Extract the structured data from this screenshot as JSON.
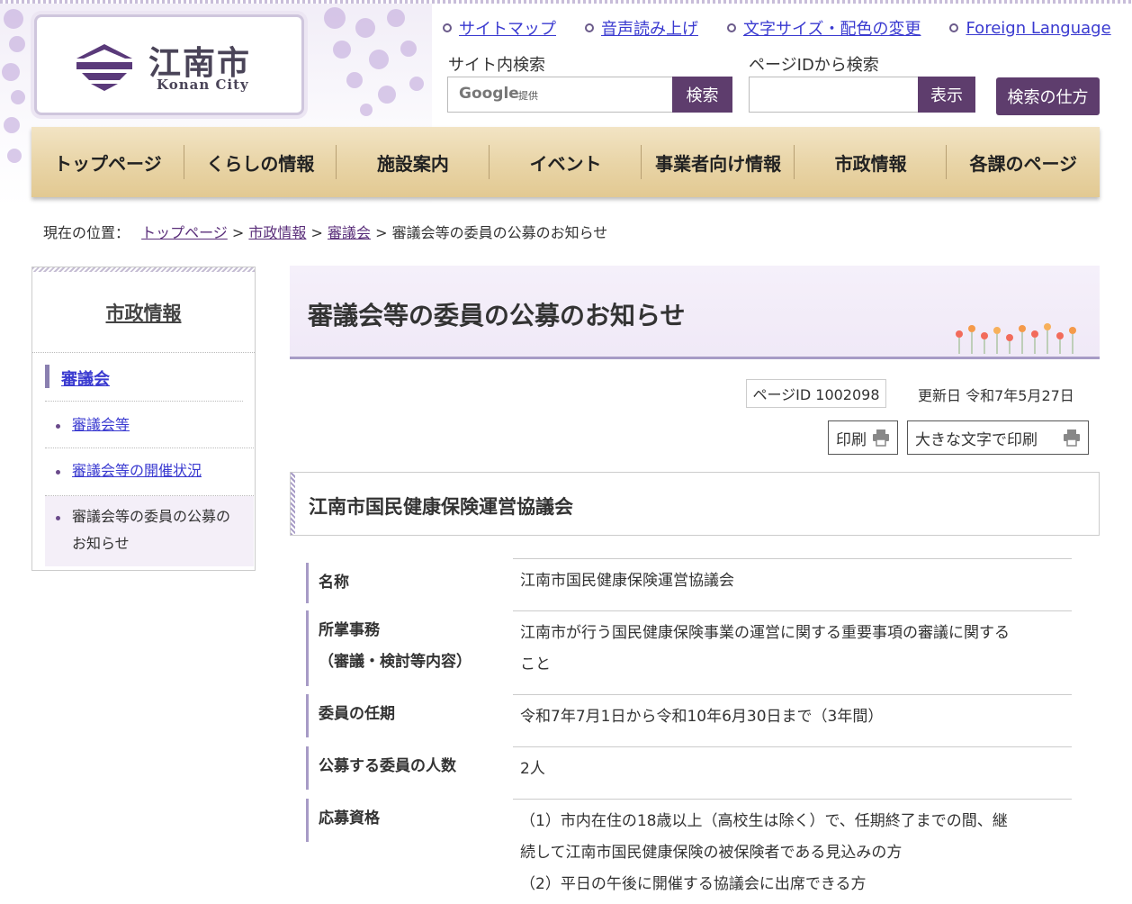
{
  "header": {
    "logo_text": "江南市",
    "logo_sub": "Konan City",
    "links": [
      "サイトマップ",
      "音声読み上げ",
      "文字サイズ・配色の変更",
      "Foreign Language"
    ],
    "site_search_label": "サイト内検索",
    "google_label": "Google",
    "google_provided": "提供",
    "search_button": "検索",
    "pageid_search_label": "ページIDから検索",
    "show_button": "表示",
    "howto_button": "検索の仕方",
    "accent_color": "#5e3d6d"
  },
  "nav": [
    "トップページ",
    "くらしの情報",
    "施設案内",
    "イベント",
    "事業者向け情報",
    "市政情報",
    "各課のページ"
  ],
  "breadcrumb": {
    "prefix": "現在の位置：",
    "items": [
      "トップページ",
      "市政情報",
      "審議会"
    ],
    "sep": ">",
    "current": "審議会等の委員の公募のお知らせ"
  },
  "sidebar": {
    "title": "市政情報",
    "current_section": "審議会",
    "items": [
      "審議会等",
      "審議会等の開催状況"
    ],
    "active_item_line1": "審議会等の委員の公募の",
    "active_item_line2": "お知らせ"
  },
  "page": {
    "title": "審議会等の委員の公募のお知らせ",
    "page_id": "ページID 1002098",
    "updated": "更新日 令和7年5月27日",
    "print_label": "印刷",
    "print_large_label": "大きな文字で印刷",
    "section_title": "江南市国民健康保険運営協議会"
  },
  "table": [
    {
      "th": "名称",
      "td": [
        "江南市国民健康保険運営協議会"
      ]
    },
    {
      "th": "所掌事務",
      "th2": "（審議・検討等内容）",
      "td": [
        "江南市が行う国民健康保険事業の運営に関する重要事項の審議に関する",
        "こと"
      ]
    },
    {
      "th": "委員の任期",
      "td": [
        "令和7年7月1日から令和10年6月30日まで（3年間）"
      ]
    },
    {
      "th": "公募する委員の人数",
      "td": [
        "2人"
      ]
    },
    {
      "th": "応募資格",
      "td": [
        "（1）市内在住の18歳以上（高校生は除く）で、任期終了までの間、継",
        "続して江南市国民健康保険の被保険者である見込みの方",
        "（2）平日の午後に開催する協議会に出席できる方"
      ]
    }
  ]
}
